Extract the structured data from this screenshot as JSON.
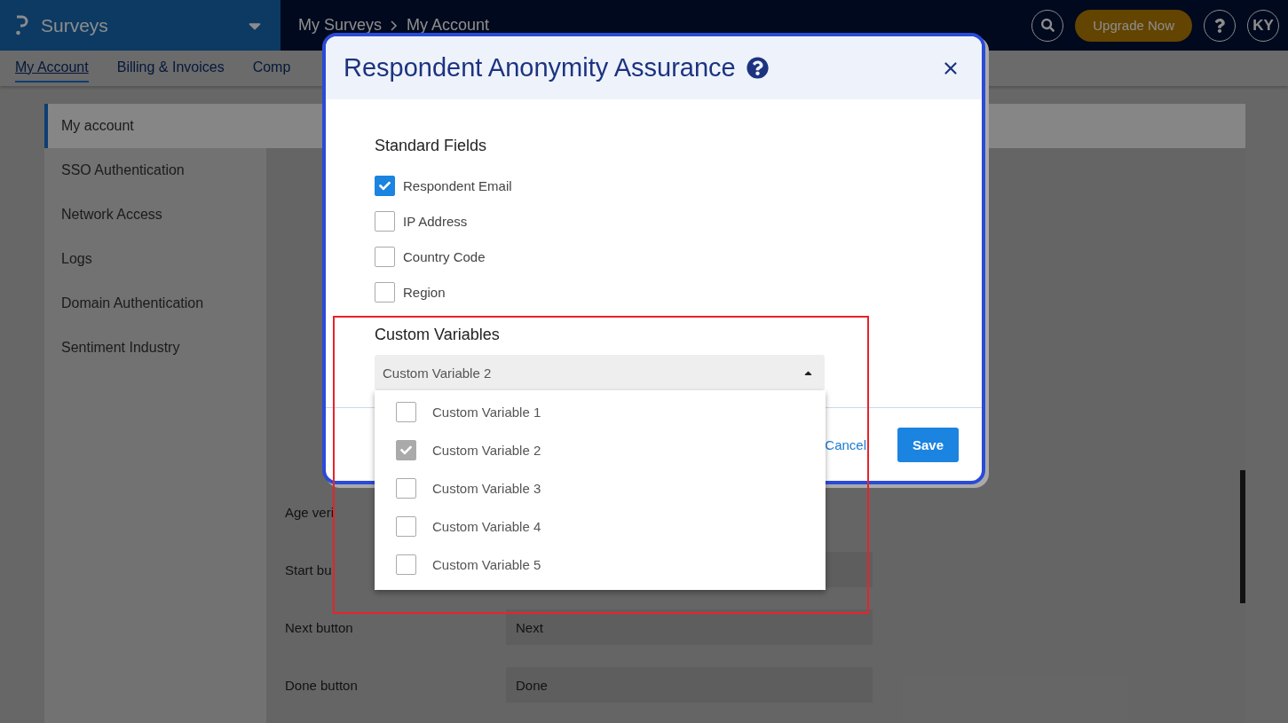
{
  "header": {
    "brand": "Surveys",
    "breadcrumb": [
      "My Surveys",
      "My Account"
    ],
    "upgrade": "Upgrade Now",
    "avatar": "KY"
  },
  "tabs": [
    {
      "label": "My Account",
      "selected": true
    },
    {
      "label": "Billing & Invoices",
      "selected": false
    },
    {
      "label": "Comp",
      "selected": false
    }
  ],
  "sidebar": {
    "items": [
      {
        "label": "My account",
        "selected": true
      },
      {
        "label": "SSO Authentication",
        "selected": false
      },
      {
        "label": "Network Access",
        "selected": false
      },
      {
        "label": "Logs",
        "selected": false
      },
      {
        "label": "Domain Authentication",
        "selected": false
      },
      {
        "label": "Sentiment Industry",
        "selected": false
      }
    ]
  },
  "settings_rows": [
    {
      "label": "Age veri"
    },
    {
      "label": "Start bu",
      "value": ""
    },
    {
      "label": "Next button",
      "value": "Next"
    },
    {
      "label": "Done button",
      "value": "Done"
    }
  ],
  "dialog": {
    "title": "Respondent Anonymity Assurance",
    "standard_heading": "Standard Fields",
    "standard_fields": [
      {
        "label": "Respondent Email",
        "checked": true
      },
      {
        "label": "IP Address",
        "checked": false
      },
      {
        "label": "Country Code",
        "checked": false
      },
      {
        "label": "Region",
        "checked": false
      }
    ],
    "custom_heading": "Custom Variables",
    "select_value": "Custom Variable 2",
    "options": [
      {
        "label": "Custom Variable 1",
        "checked": false
      },
      {
        "label": "Custom Variable 2",
        "checked": true
      },
      {
        "label": "Custom Variable 3",
        "checked": false
      },
      {
        "label": "Custom Variable 4",
        "checked": false
      },
      {
        "label": "Custom Variable 5",
        "checked": false
      }
    ],
    "cancel": "Cancel",
    "save": "Save"
  }
}
